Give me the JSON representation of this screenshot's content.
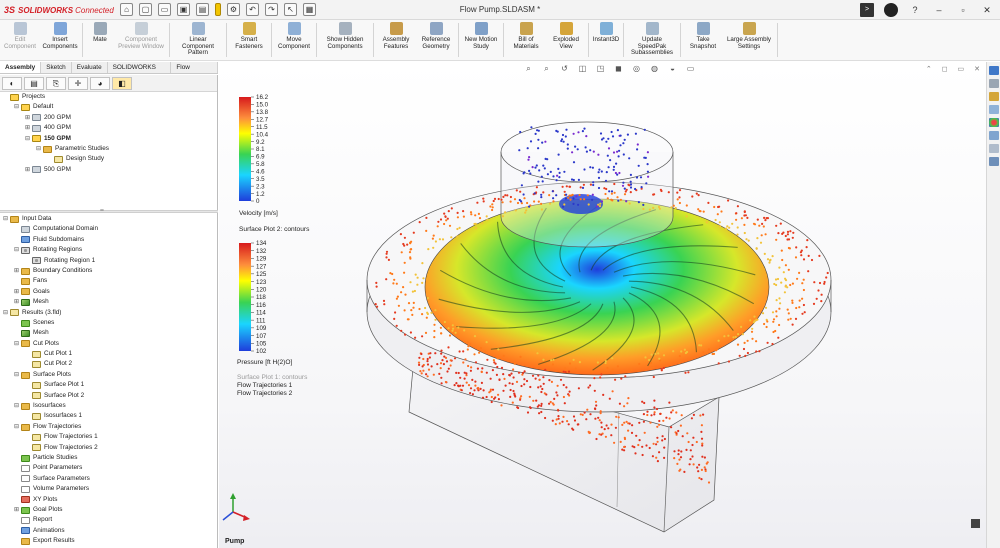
{
  "titlebar": {
    "app_logo_ds": "3S",
    "app_logo_text": "SOLIDWORKS",
    "app_logo_suffix": "Connected",
    "document_title": "Flow Pump.SLDASM *"
  },
  "ribbon": [
    {
      "label": "Edit Component",
      "disabled": true,
      "color": "#b9c6d6"
    },
    {
      "label": "Insert Components",
      "disabled": false,
      "color": "#7fa6d9"
    },
    {
      "label": "Mate",
      "disabled": false,
      "color": "#9aa9b8"
    },
    {
      "label": "Component Preview Window",
      "disabled": true,
      "color": "#c6cfd8"
    },
    {
      "label": "Linear Component Pattern",
      "disabled": false,
      "color": "#9db5d1"
    },
    {
      "label": "Smart Fasteners",
      "disabled": false,
      "color": "#d6b04a"
    },
    {
      "label": "Move Component",
      "disabled": false,
      "color": "#8fb0d6"
    },
    {
      "label": "Show Hidden Components",
      "disabled": false,
      "color": "#a6b2bf"
    },
    {
      "label": "Assembly Features",
      "disabled": false,
      "color": "#c79b4a"
    },
    {
      "label": "Reference Geometry",
      "disabled": false,
      "color": "#8fa6c4"
    },
    {
      "label": "New Motion Study",
      "disabled": false,
      "color": "#7fa0c8"
    },
    {
      "label": "Bill of Materials",
      "disabled": false,
      "color": "#c9a34e"
    },
    {
      "label": "Exploded View",
      "disabled": false,
      "color": "#d5a53a"
    },
    {
      "label": "Instant3D",
      "disabled": false,
      "color": "#7fb0d8"
    },
    {
      "label": "Update SpeedPak Subassemblies",
      "disabled": false,
      "color": "#a3b7cb"
    },
    {
      "label": "Take Snapshot",
      "disabled": false,
      "color": "#8da8c6"
    },
    {
      "label": "Large Assembly Settings",
      "disabled": false,
      "color": "#c9a54f"
    }
  ],
  "tabs": [
    "Assembly",
    "Sketch",
    "Evaluate",
    "SOLIDWORKS Add-Ins",
    "Flow Simulation"
  ],
  "tree_top": [
    {
      "label": "Projects",
      "level": 0,
      "icon": "i-cube",
      "exp": "",
      "bold": false
    },
    {
      "label": "Default",
      "level": 1,
      "icon": "i-cube",
      "exp": "-",
      "bold": false
    },
    {
      "label": "200 GPM",
      "level": 2,
      "icon": "i-gray",
      "exp": "+",
      "bold": false
    },
    {
      "label": "400 GPM",
      "level": 2,
      "icon": "i-gray",
      "exp": "+",
      "bold": false
    },
    {
      "label": "150 GPM",
      "level": 2,
      "icon": "i-cube",
      "exp": "-",
      "bold": true
    },
    {
      "label": "Parametric Studies",
      "level": 3,
      "icon": "i-folder",
      "exp": "-",
      "bold": false
    },
    {
      "label": "Design Study",
      "level": 4,
      "icon": "i-plot",
      "exp": "",
      "bold": false
    },
    {
      "label": "500 GPM",
      "level": 2,
      "icon": "i-gray",
      "exp": "+",
      "bold": false
    }
  ],
  "tree_bottom": [
    {
      "label": "Input Data",
      "level": 0,
      "icon": "i-folder",
      "exp": "-"
    },
    {
      "label": "Computational Domain",
      "level": 1,
      "icon": "i-gray",
      "exp": ""
    },
    {
      "label": "Fluid Subdomains",
      "level": 1,
      "icon": "i-blue",
      "exp": ""
    },
    {
      "label": "Rotating Regions",
      "level": 1,
      "icon": "i-gear",
      "exp": "-"
    },
    {
      "label": "Rotating Region 1",
      "level": 2,
      "icon": "i-gear",
      "exp": ""
    },
    {
      "label": "Boundary Conditions",
      "level": 1,
      "icon": "i-folder",
      "exp": "+"
    },
    {
      "label": "Fans",
      "level": 1,
      "icon": "i-folder",
      "exp": ""
    },
    {
      "label": "Goals",
      "level": 1,
      "icon": "i-folder",
      "exp": "+"
    },
    {
      "label": "Mesh",
      "level": 1,
      "icon": "i-mesh",
      "exp": "+"
    },
    {
      "label": "Results (3.fld)",
      "level": 0,
      "icon": "i-plot",
      "exp": "-"
    },
    {
      "label": "Scenes",
      "level": 1,
      "icon": "i-green",
      "exp": ""
    },
    {
      "label": "Mesh",
      "level": 1,
      "icon": "i-mesh",
      "exp": ""
    },
    {
      "label": "Cut Plots",
      "level": 1,
      "icon": "i-folder",
      "exp": "-"
    },
    {
      "label": "Cut Plot 1",
      "level": 2,
      "icon": "i-plot",
      "exp": ""
    },
    {
      "label": "Cut Plot 2",
      "level": 2,
      "icon": "i-plot",
      "exp": ""
    },
    {
      "label": "Surface Plots",
      "level": 1,
      "icon": "i-folder",
      "exp": "-"
    },
    {
      "label": "Surface Plot 1",
      "level": 2,
      "icon": "i-plot",
      "exp": ""
    },
    {
      "label": "Surface Plot 2",
      "level": 2,
      "icon": "i-plot",
      "exp": ""
    },
    {
      "label": "Isosurfaces",
      "level": 1,
      "icon": "i-folder",
      "exp": "-"
    },
    {
      "label": "Isosurfaces 1",
      "level": 2,
      "icon": "i-plot",
      "exp": ""
    },
    {
      "label": "Flow Trajectories",
      "level": 1,
      "icon": "i-folder",
      "exp": "-"
    },
    {
      "label": "Flow Trajectories 1",
      "level": 2,
      "icon": "i-plot",
      "exp": ""
    },
    {
      "label": "Flow Trajectories 2",
      "level": 2,
      "icon": "i-plot",
      "exp": ""
    },
    {
      "label": "Particle Studies",
      "level": 1,
      "icon": "i-green",
      "exp": ""
    },
    {
      "label": "Point Parameters",
      "level": 1,
      "icon": "i-doc",
      "exp": ""
    },
    {
      "label": "Surface Parameters",
      "level": 1,
      "icon": "i-doc",
      "exp": ""
    },
    {
      "label": "Volume Parameters",
      "level": 1,
      "icon": "i-doc",
      "exp": ""
    },
    {
      "label": "XY Plots",
      "level": 1,
      "icon": "i-red",
      "exp": ""
    },
    {
      "label": "Goal Plots",
      "level": 1,
      "icon": "i-green",
      "exp": "+"
    },
    {
      "label": "Report",
      "level": 1,
      "icon": "i-doc",
      "exp": ""
    },
    {
      "label": "Animations",
      "level": 1,
      "icon": "i-blue",
      "exp": ""
    },
    {
      "label": "Export Results",
      "level": 1,
      "icon": "i-folder",
      "exp": ""
    }
  ],
  "legend_velocity": {
    "values": [
      "16.2",
      "15.0",
      "13.8",
      "12.7",
      "11.5",
      "10.4",
      "9.2",
      "8.1",
      "6.9",
      "5.8",
      "4.6",
      "3.5",
      "2.3",
      "1.2",
      "0"
    ],
    "caption": "Velocity [m/s]",
    "title": "Surface Plot 2: contours"
  },
  "legend_pressure": {
    "values": [
      "134",
      "132",
      "129",
      "127",
      "125",
      "123",
      "120",
      "118",
      "116",
      "114",
      "111",
      "109",
      "107",
      "105",
      "102"
    ],
    "caption": "Pressure [ft H(2)O]",
    "extra_dim": "Surface Plot 1: contours",
    "extra": [
      "Flow Trajectories 1",
      "Flow Trajectories 2"
    ]
  },
  "viewport": {
    "model_name": "Pump"
  },
  "colors": {
    "brand_red": "#d42027",
    "selection": "#ffe9a8"
  }
}
